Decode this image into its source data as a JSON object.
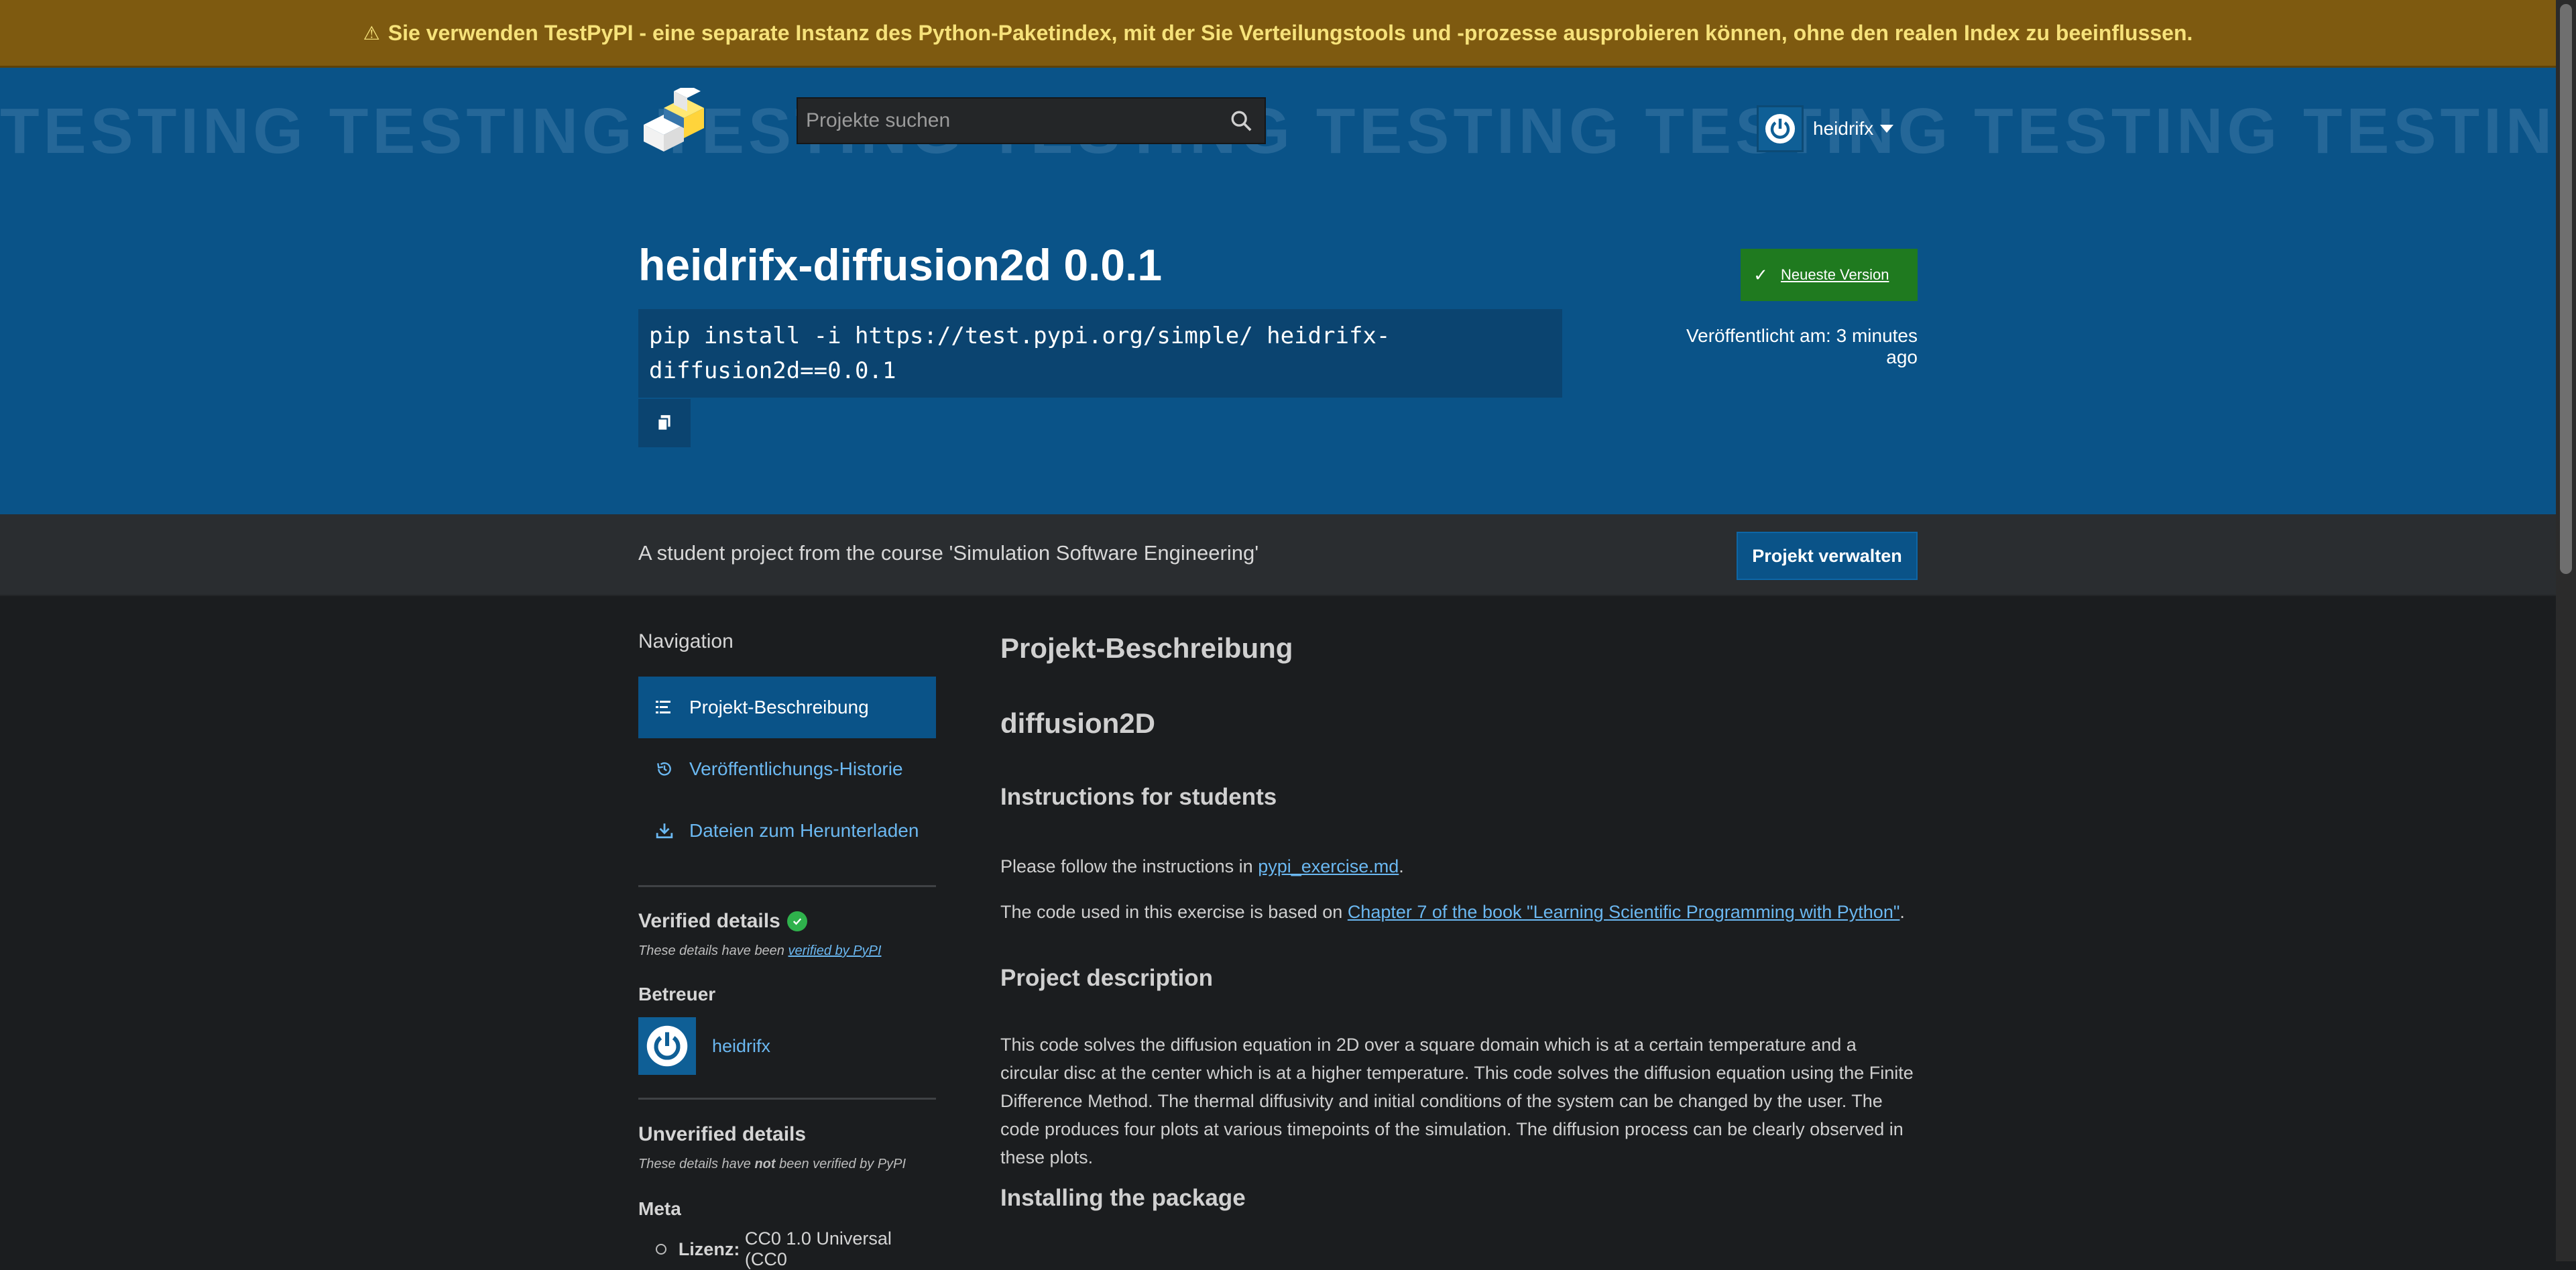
{
  "banner": {
    "icon": "warning-icon",
    "text": "Sie verwenden TestPyPI - eine separate Instanz des Python-Paketindex, mit der Sie Verteilungstools und -prozesse ausprobieren können, ohne den realen Index zu beeinflussen."
  },
  "header": {
    "watermark": "TESTING TESTING TESTING TESTING TESTING TESTING TESTING TESTING TESTING TESTING TESTING TESTING TESTING",
    "search_placeholder": "Projekte suchen",
    "username": "heidrifx"
  },
  "package": {
    "title": "heidrifx-diffusion2d 0.0.1",
    "pip_command": "pip install -i https://test.pypi.org/simple/ heidrifx-\ndiffusion2d==0.0.1",
    "latest_label": "Neueste Version",
    "released": "Veröffentlicht am: 3 minutes ago"
  },
  "summary": {
    "description": "A student project from the course 'Simulation Software Engineering'",
    "manage_label": "Projekt verwalten"
  },
  "sidebar": {
    "nav_title": "Navigation",
    "items": [
      {
        "label": "Projekt-Beschreibung"
      },
      {
        "label": "Veröffentlichungs-Historie"
      },
      {
        "label": "Dateien zum Herunterladen"
      }
    ],
    "verified_title": "Verified details",
    "verified_note_prefix": "These details have been ",
    "verified_note_link": "verified by PyPI",
    "maintainers_title": "Betreuer",
    "maintainer": "heidrifx",
    "unverified_title": "Unverified details",
    "unverified_note_a": "These details have ",
    "unverified_note_b": "not",
    "unverified_note_c": " been verified by PyPI",
    "meta_title": "Meta",
    "license_label": "Lizenz:",
    "license_value": "CC0 1.0 Universal (CC0"
  },
  "content": {
    "heading": "Projekt-Beschreibung",
    "h1": "diffusion2D",
    "h2_instructions": "Instructions for students",
    "p1_prefix": "Please follow the instructions in ",
    "p1_link": "pypi_exercise.md",
    "p1_suffix": ".",
    "p2_prefix": "The code used in this exercise is based on ",
    "p2_link": "Chapter 7 of the book \"Learning Scientific Programming with Python\"",
    "p2_suffix": ".",
    "h2_description": "Project description",
    "p3": "This code solves the diffusion equation in 2D over a square domain which is at a certain temperature and a circular disc at the center which is at a higher temperature. This code solves the diffusion equation using the Finite Difference Method. The thermal diffusivity and initial conditions of the system can be changed by the user. The code produces four plots at various timepoints of the simulation. The diffusion process can be clearly observed in these plots.",
    "h2_install": "Installing the package"
  }
}
